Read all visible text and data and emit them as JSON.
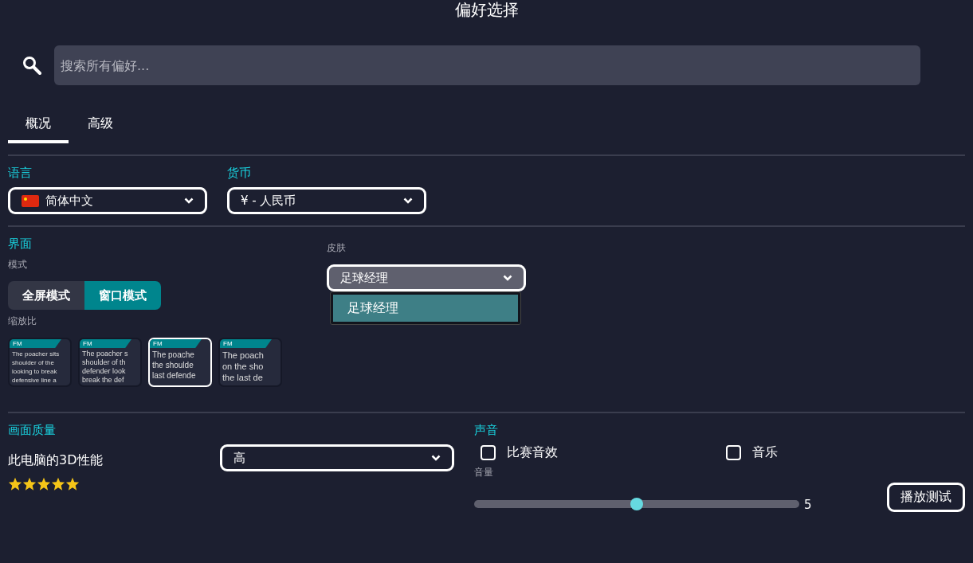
{
  "window": {
    "title": "偏好选择"
  },
  "search": {
    "placeholder": "搜索所有偏好..."
  },
  "tabs": [
    {
      "label": "概况",
      "selected": true
    },
    {
      "label": "高级",
      "selected": false
    }
  ],
  "language": {
    "label": "语言",
    "value": "简体中文"
  },
  "currency": {
    "label": "货币",
    "value": "¥ - 人民币"
  },
  "interface": {
    "heading": "界面",
    "mode_label": "模式",
    "modes": [
      {
        "label": "全屏模式",
        "selected": false
      },
      {
        "label": "窗口模式",
        "selected": true
      }
    ],
    "scale_label": "缩放比",
    "scales": [
      {
        "badge": "FM",
        "lines": [
          "The poacher sits",
          "shoulder of the",
          "looking to break",
          "defensive line a"
        ],
        "selected": false
      },
      {
        "badge": "FM",
        "lines": [
          "The poacher s",
          "shoulder of th",
          "defender look",
          "break the def"
        ],
        "selected": false
      },
      {
        "badge": "FM",
        "lines": [
          "The poache",
          "the shoulde",
          "last defende"
        ],
        "selected": true
      },
      {
        "badge": "FM",
        "lines": [
          "The poach",
          "on the sho",
          "the last de"
        ],
        "selected": false
      }
    ],
    "skin": {
      "label": "皮肤",
      "value": "足球经理",
      "expanded": true,
      "options": [
        {
          "label": "足球经理",
          "selected": true
        }
      ]
    }
  },
  "graphics": {
    "heading": "画面质量",
    "label": "此电脑的3D性能",
    "stars": 5,
    "value": "高"
  },
  "sound": {
    "heading": "声音",
    "checkboxes": [
      {
        "label": "比赛音效",
        "checked": false
      },
      {
        "label": "音乐",
        "checked": false
      }
    ],
    "volume_label": "音量",
    "level": 0.5,
    "reading": "5",
    "test_button": "播放测试"
  }
}
